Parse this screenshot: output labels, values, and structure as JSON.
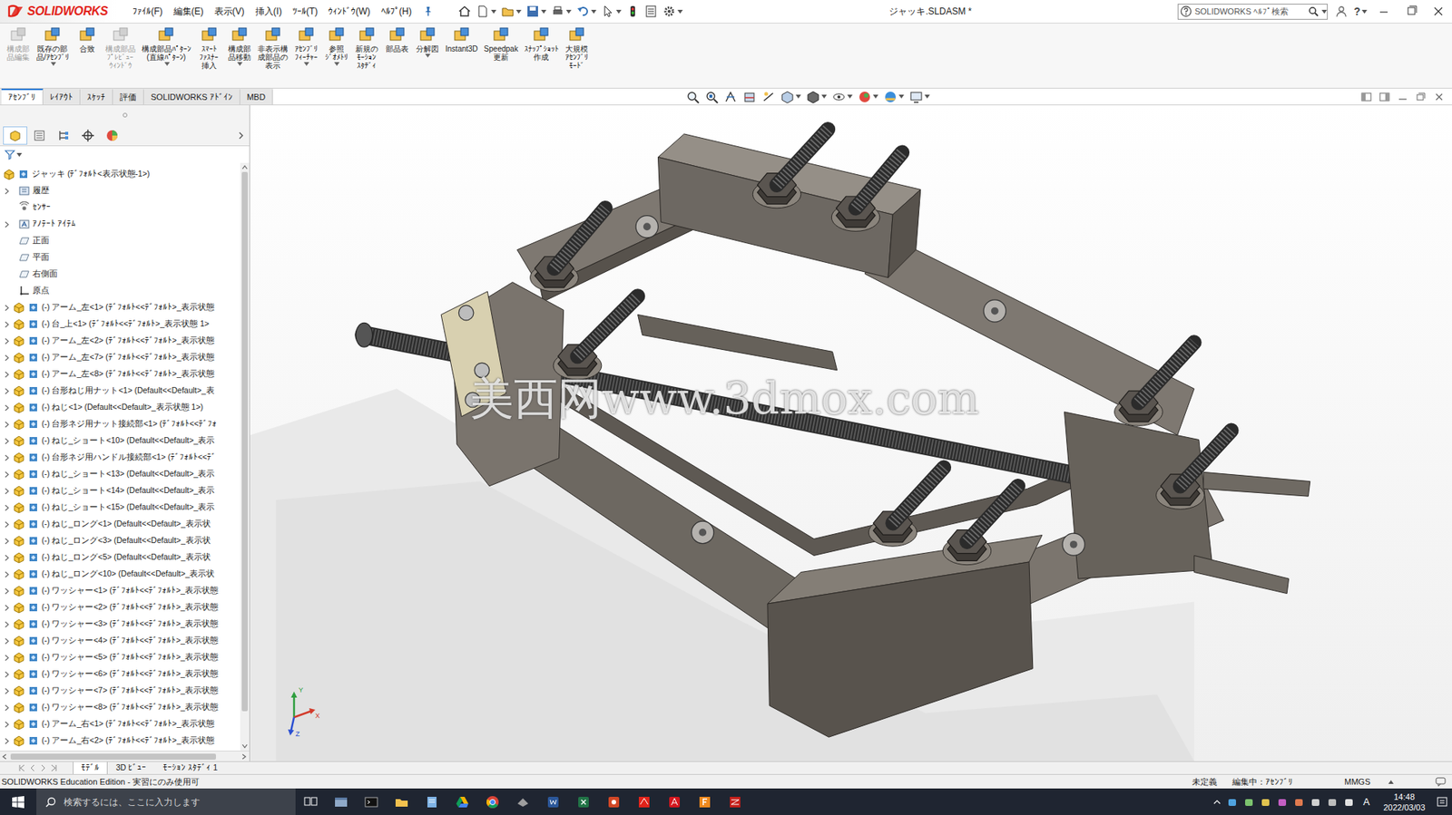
{
  "window": {
    "logo": "SOLIDWORKS",
    "title": "ジャッキ.SLDASM *",
    "help_glyph": "?"
  },
  "menu": [
    "ﾌｧｲﾙ(F)",
    "編集(E)",
    "表示(V)",
    "挿入(I)",
    "ﾂｰﾙ(T)",
    "ｳｨﾝﾄﾞｳ(W)",
    "ﾍﾙﾌﾟ(H)"
  ],
  "help_search": {
    "placeholder": "SOLIDWORKS ﾍﾙﾌﾟ検索"
  },
  "ribbon": [
    {
      "label": "構成部\n品編集",
      "disabled": true,
      "dropdown": false
    },
    {
      "label": "既存の部\n品/ｱｾﾝﾌﾞﾘ",
      "disabled": false,
      "dropdown": true
    },
    {
      "label": "合致",
      "disabled": false,
      "dropdown": false
    },
    {
      "label": "構成部品\nﾌﾟﾚﾋﾞｭｰ\nｳｨﾝﾄﾞｳ",
      "disabled": true,
      "dropdown": false
    },
    {
      "label": "構成部品ﾊﾟﾀｰﾝ\n(直線ﾊﾟﾀｰﾝ)",
      "disabled": false,
      "dropdown": true
    },
    {
      "label": "ｽﾏｰﾄ\nﾌｧｽﾅｰ\n挿入",
      "disabled": false,
      "dropdown": false
    },
    {
      "label": "構成部\n品移動",
      "disabled": false,
      "dropdown": true
    },
    {
      "label": "非表示構\n成部品の\n表示",
      "disabled": false,
      "dropdown": false
    },
    {
      "label": "ｱｾﾝﾌﾞﾘ\nﾌｨｰﾁｬｰ",
      "disabled": false,
      "dropdown": true
    },
    {
      "label": "参照\nｼﾞｵﾒﾄﾘ",
      "disabled": false,
      "dropdown": true
    },
    {
      "label": "新規の\nﾓｰｼｮﾝ\nｽﾀﾃﾞｨ",
      "disabled": false,
      "dropdown": false
    },
    {
      "label": "部品表",
      "disabled": false,
      "dropdown": false
    },
    {
      "label": "分解図",
      "disabled": false,
      "dropdown": true
    },
    {
      "label": "Instant3D",
      "disabled": false,
      "dropdown": false
    },
    {
      "label": "Speedpak\n更新",
      "disabled": false,
      "dropdown": false
    },
    {
      "label": "ｽﾅｯﾌﾟｼｮｯﾄ\n作成",
      "disabled": false,
      "dropdown": false
    },
    {
      "label": "大規模\nｱｾﾝﾌﾞﾘ\nﾓｰﾄﾞ",
      "disabled": false,
      "dropdown": false
    }
  ],
  "tabs": [
    {
      "label": "ｱｾﾝﾌﾞﾘ",
      "selected": true
    },
    {
      "label": "ﾚｲｱｳﾄ",
      "selected": false
    },
    {
      "label": "ｽｹｯﾁ",
      "selected": false
    },
    {
      "label": "評価",
      "selected": false
    },
    {
      "label": "SOLIDWORKS ｱﾄﾞｲﾝ",
      "selected": false
    },
    {
      "label": "MBD",
      "selected": false
    }
  ],
  "panel_tabs": [
    {
      "selected": true
    },
    {
      "selected": false
    },
    {
      "selected": false
    },
    {
      "selected": false
    },
    {
      "selected": false
    }
  ],
  "tree": {
    "root": "ジャッキ (ﾃﾞﾌｫﾙﾄ<表示状態-1>)",
    "items": [
      {
        "label": "履歴",
        "kind": "history",
        "expandable": true
      },
      {
        "label": "ｾﾝｻｰ",
        "kind": "sensor",
        "expandable": false
      },
      {
        "label": "ｱﾉﾃｰﾄ ｱｲﾃﾑ",
        "kind": "annotation",
        "expandable": true
      },
      {
        "label": "正面",
        "kind": "plane",
        "expandable": false
      },
      {
        "label": "平面",
        "kind": "plane",
        "expandable": false
      },
      {
        "label": "右側面",
        "kind": "plane",
        "expandable": false
      },
      {
        "label": "原点",
        "kind": "origin",
        "expandable": false
      },
      {
        "label": "(-) アーム_左<1> (ﾃﾞﾌｫﾙﾄ<<ﾃﾞﾌｫﾙﾄ>_表示状態",
        "kind": "component",
        "expandable": true
      },
      {
        "label": "(-) 台_上<1> (ﾃﾞﾌｫﾙﾄ<<ﾃﾞﾌｫﾙﾄ>_表示状態 1>",
        "kind": "component",
        "expandable": true
      },
      {
        "label": "(-) アーム_左<2> (ﾃﾞﾌｫﾙﾄ<<ﾃﾞﾌｫﾙﾄ>_表示状態",
        "kind": "component",
        "expandable": true
      },
      {
        "label": "(-) アーム_左<7> (ﾃﾞﾌｫﾙﾄ<<ﾃﾞﾌｫﾙﾄ>_表示状態",
        "kind": "component",
        "expandable": true
      },
      {
        "label": "(-) アーム_左<8> (ﾃﾞﾌｫﾙﾄ<<ﾃﾞﾌｫﾙﾄ>_表示状態",
        "kind": "component",
        "expandable": true
      },
      {
        "label": "(-) 台形ねじ用ナット<1> (Default<<Default>_表",
        "kind": "component",
        "expandable": true
      },
      {
        "label": "(-) ねじ<1> (Default<<Default>_表示状態 1>)",
        "kind": "component",
        "expandable": true
      },
      {
        "label": "(-) 台形ネジ用ナット接続部<1> (ﾃﾞﾌｫﾙﾄ<<ﾃﾞﾌｫ",
        "kind": "component",
        "expandable": true
      },
      {
        "label": "(-) ねじ_ショート<10> (Default<<Default>_表示",
        "kind": "component",
        "expandable": true
      },
      {
        "label": "(-) 台形ネジ用ハンドル接続部<1> (ﾃﾞﾌｫﾙﾄ<<ﾃﾞ",
        "kind": "component",
        "expandable": true
      },
      {
        "label": "(-) ねじ_ショート<13> (Default<<Default>_表示",
        "kind": "component",
        "expandable": true
      },
      {
        "label": "(-) ねじ_ショート<14> (Default<<Default>_表示",
        "kind": "component",
        "expandable": true
      },
      {
        "label": "(-) ねじ_ショート<15> (Default<<Default>_表示",
        "kind": "component",
        "expandable": true
      },
      {
        "label": "(-) ねじ_ロング<1> (Default<<Default>_表示状",
        "kind": "component",
        "expandable": true
      },
      {
        "label": "(-) ねじ_ロング<3> (Default<<Default>_表示状",
        "kind": "component",
        "expandable": true
      },
      {
        "label": "(-) ねじ_ロング<5> (Default<<Default>_表示状",
        "kind": "component",
        "expandable": true
      },
      {
        "label": "(-) ねじ_ロング<10> (Default<<Default>_表示状",
        "kind": "component",
        "expandable": true
      },
      {
        "label": "(-) ワッシャー<1> (ﾃﾞﾌｫﾙﾄ<<ﾃﾞﾌｫﾙﾄ>_表示状態",
        "kind": "component",
        "expandable": true
      },
      {
        "label": "(-) ワッシャー<2> (ﾃﾞﾌｫﾙﾄ<<ﾃﾞﾌｫﾙﾄ>_表示状態",
        "kind": "component",
        "expandable": true
      },
      {
        "label": "(-) ワッシャー<3> (ﾃﾞﾌｫﾙﾄ<<ﾃﾞﾌｫﾙﾄ>_表示状態",
        "kind": "component",
        "expandable": true
      },
      {
        "label": "(-) ワッシャー<4> (ﾃﾞﾌｫﾙﾄ<<ﾃﾞﾌｫﾙﾄ>_表示状態",
        "kind": "component",
        "expandable": true
      },
      {
        "label": "(-) ワッシャー<5> (ﾃﾞﾌｫﾙﾄ<<ﾃﾞﾌｫﾙﾄ>_表示状態",
        "kind": "component",
        "expandable": true
      },
      {
        "label": "(-) ワッシャー<6> (ﾃﾞﾌｫﾙﾄ<<ﾃﾞﾌｫﾙﾄ>_表示状態",
        "kind": "component",
        "expandable": true
      },
      {
        "label": "(-) ワッシャー<7> (ﾃﾞﾌｫﾙﾄ<<ﾃﾞﾌｫﾙﾄ>_表示状態",
        "kind": "component",
        "expandable": true
      },
      {
        "label": "(-) ワッシャー<8> (ﾃﾞﾌｫﾙﾄ<<ﾃﾞﾌｫﾙﾄ>_表示状態",
        "kind": "component",
        "expandable": true
      },
      {
        "label": "(-) アーム_右<1> (ﾃﾞﾌｫﾙﾄ<<ﾃﾞﾌｫﾙﾄ>_表示状態",
        "kind": "component",
        "expandable": true
      },
      {
        "label": "(-) アーム_右<2> (ﾃﾞﾌｫﾙﾄ<<ﾃﾞﾌｫﾙﾄ>_表示状態",
        "kind": "component",
        "expandable": true
      }
    ]
  },
  "viewport": {
    "watermark": "美西网www.3dmox.com",
    "triad": [
      "Y",
      "X",
      "Z"
    ]
  },
  "bottom_tabs": [
    {
      "label": "ﾓﾃﾞﾙ",
      "selected": true
    },
    {
      "label": "3D ﾋﾞｭｰ",
      "selected": false
    },
    {
      "label": "ﾓｰｼｮﾝ ｽﾀﾃﾞｨ 1",
      "selected": false
    }
  ],
  "status_bar": {
    "edition": "SOLIDWORKS Education Edition - 実習にのみ使用可",
    "state": "未定義",
    "editing": "編集中：ｱｾﾝﾌﾞﾘ",
    "units": "MMGS"
  },
  "taskbar": {
    "search_placeholder": "検索するには、ここに入力します",
    "ime": "A",
    "time": "14:48",
    "date": "2022/03/03"
  }
}
